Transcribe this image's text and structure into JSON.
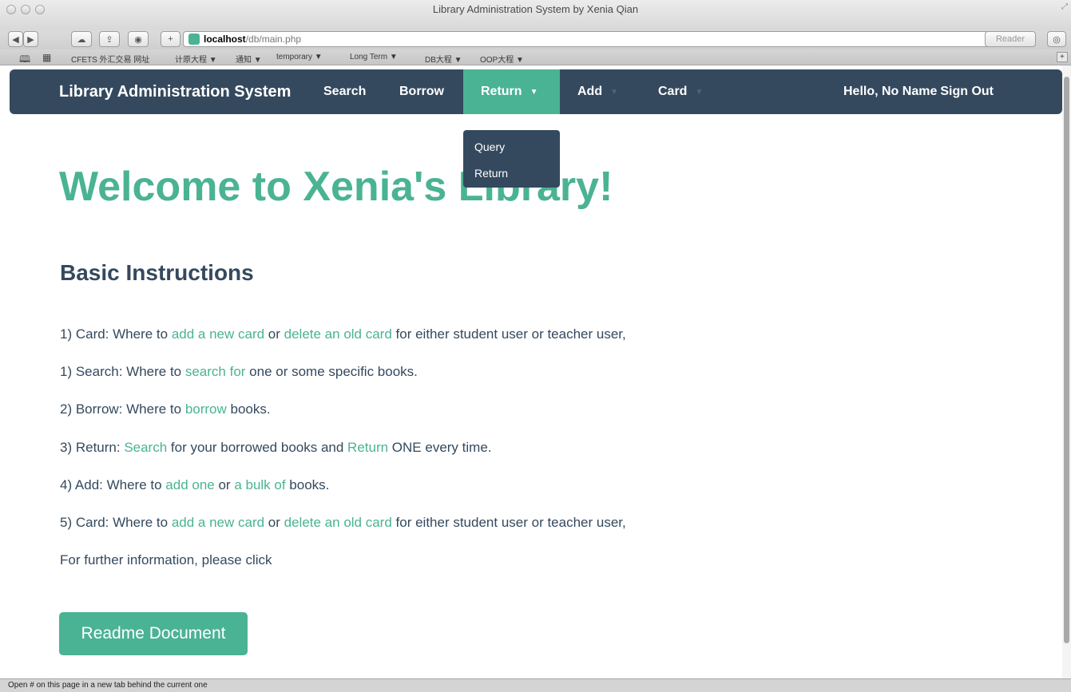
{
  "window": {
    "title": "Library Administration System by Xenia Qian"
  },
  "toolbar": {
    "url_host": "localhost",
    "url_path": "/db/main.php",
    "reader_label": "Reader"
  },
  "bookmarks": [
    "CFETS 外汇交易 网址",
    "计原大程 ▼",
    "通知 ▼",
    "temporary ▼",
    "Long Term ▼",
    "DB大程 ▼",
    "OOP大程 ▼"
  ],
  "navbar": {
    "brand": "Library Administration System",
    "items": [
      "Search",
      "Borrow",
      "Return",
      "Add",
      "Card"
    ],
    "user_greeting": "Hello, No Name",
    "sign_out": "Sign Out"
  },
  "dropdown": {
    "items": [
      "Query",
      "Return"
    ]
  },
  "main": {
    "welcome": "Welcome to Xenia's Library!",
    "instructions_title": "Basic Instructions",
    "lines": [
      {
        "a": "1) Card:  Where to ",
        "l1": "add a new card",
        "b": " or ",
        "l2": "delete an old card",
        "c": " for either student user or teacher user,"
      },
      {
        "a": "1) Search:  Where to ",
        "l1": "search for",
        "b": " one or some specific books."
      },
      {
        "a": "2) Borrow:  Where to ",
        "l1": "borrow",
        "b": " books."
      },
      {
        "a": "3) Return:  ",
        "l1": "Search",
        "b": " for your borrowed books and ",
        "l2": "Return",
        "c": " ONE every time."
      },
      {
        "a": "4) Add:  Where to ",
        "l1": "add one",
        "b": " or ",
        "l2": "a bulk of",
        "c": " books."
      },
      {
        "a": "5) Card:  Where to ",
        "l1": "add a new card",
        "b": " or ",
        "l2": "delete an old card",
        "c": " for either student user or teacher user,"
      },
      {
        "a": "For further information,  please click"
      }
    ],
    "readme_button": "Readme Document"
  },
  "status_bar": "Open # on this page in a new tab behind the current one"
}
